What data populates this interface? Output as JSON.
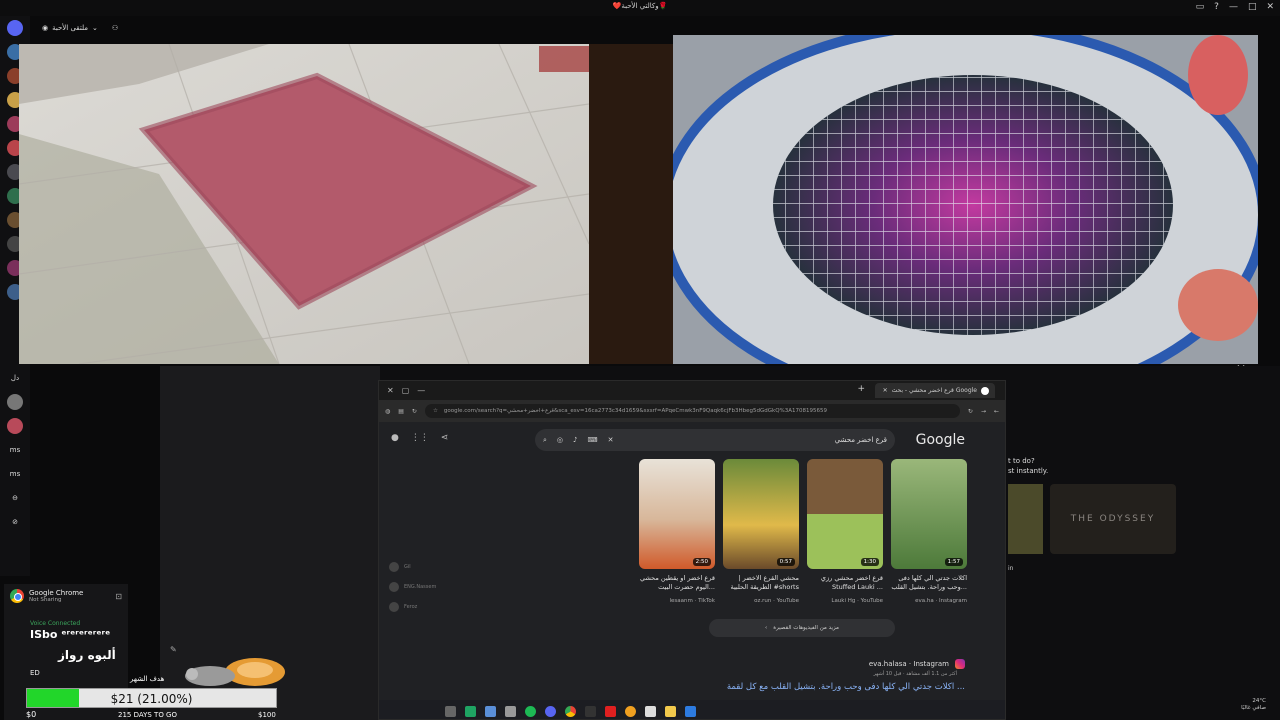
{
  "window": {
    "title": "❤️وكالتي الأحبة🌹"
  },
  "call": {
    "channel_name": "ملتقى الأحبة"
  },
  "chrome": {
    "tab_title": "قرع اخضر محشي - بحث Google",
    "url": "google.com/search?q=قرع+اخضر+محشي&sca_esv=16ca2773c34d1659&sxsrf=APqeCmwk3nF9Qaqk6cjFb3Hbeg5dGdGkQ%3A1708195659",
    "search_query": "قرع اخضر محشي",
    "google_logo": "Google"
  },
  "videos": [
    {
      "duration": "1:57",
      "title": "اكلات جدتي الي كلها دفى وحب وراحة. بتشيل القلب...",
      "source": "eva.ha · Instagram"
    },
    {
      "duration": "1:30",
      "title": "قرع اخضر محشي رزي Stuffed Lauki ...",
      "source": "Lauki Hg · YouTube"
    },
    {
      "duration": "0:57",
      "title": "محشي القرع الاخضر | الطريقة الحلبية #shorts",
      "source": "oz.run · YouTube"
    },
    {
      "duration": "2:50",
      "title": "قرع اخضر او يقطين محشي اليوم حضرت البيت...",
      "source": "lesaanm · TikTok"
    }
  ],
  "more_videos": "مزيد من الفيديوهات القصيرة",
  "result": {
    "site": "eva.halasa · Instagram",
    "meta": "أكثر من 1.1 ألف مشاهد · قبل 10 أشهر",
    "link": "اكلات جدتي الي كلها دفى وحب وراحة. بتشيل القلب مع كل لقمة ..."
  },
  "left_list": [
    "Gil",
    "ENG.Nassem",
    "Feroz"
  ],
  "explore": {
    "line1": "t to do?",
    "line2": "st instantly.",
    "card": "THE ODYSSEY",
    "tail": "in"
  },
  "left_icons": [
    "دل",
    "ms",
    "ms"
  ],
  "voice_panel": {
    "app": "Google Chrome",
    "status": "Not Sharing",
    "voice_status": "Voice Connected",
    "user": "ED"
  },
  "watermark": {
    "line1": "ISbo ᵉʳᵉʳᵉʳᵉʳᵉʳᵉ",
    "line2": "ألبوه رواز"
  },
  "goal": {
    "label": "هدف الشهر",
    "amount": "$21 (21.00%)",
    "progress": 0.21,
    "start": "$0",
    "days": "215 DAYS TO GO",
    "target": "$100"
  },
  "tray": {
    "temp": "24°C",
    "time": "صافي غالبًا"
  },
  "colors": {
    "goal_fill": "#22d62a",
    "link": "#8ab4f8"
  }
}
